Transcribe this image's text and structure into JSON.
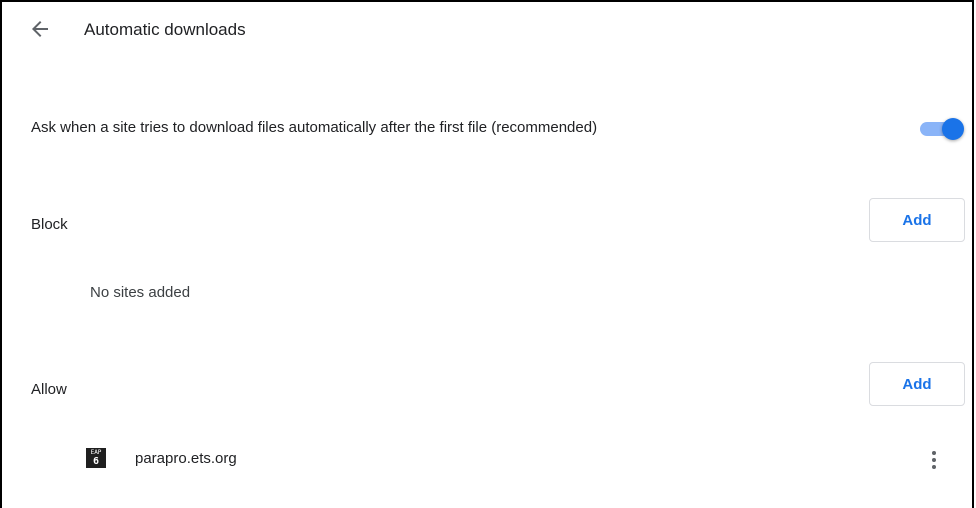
{
  "header": {
    "title": "Automatic downloads",
    "back_icon": "arrow-back-icon"
  },
  "setting": {
    "label": "Ask when a site tries to download files automatically after the first file (recommended)",
    "enabled": true,
    "accent": "#1a73e8"
  },
  "block": {
    "label": "Block",
    "add_label": "Add",
    "empty_text": "No sites added"
  },
  "allow": {
    "label": "Allow",
    "add_label": "Add",
    "sites": [
      {
        "favicon_text_top": "EAP",
        "favicon_text_bottom": "6",
        "name": "parapro.ets.org",
        "more_icon": "more-vert-icon"
      }
    ]
  }
}
